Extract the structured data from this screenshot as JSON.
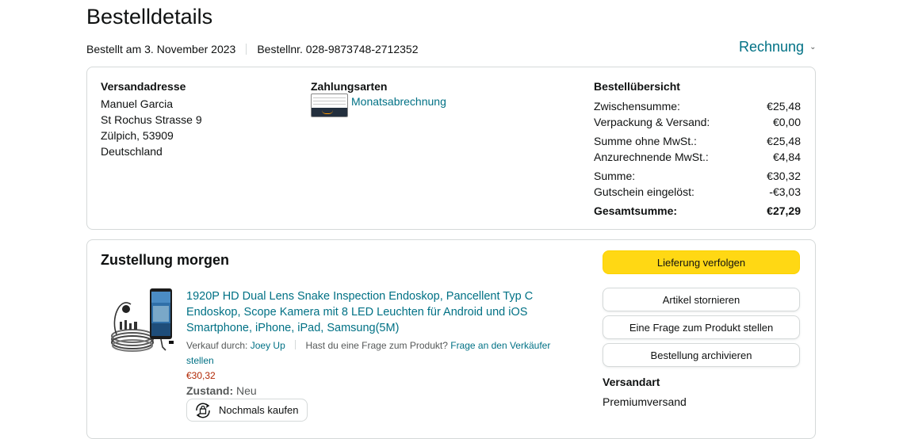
{
  "page_title": "Bestelldetails",
  "order_meta": {
    "ordered": "Bestellt am 3. November 2023",
    "order_number": "Bestellnr. 028-9873748-2712352"
  },
  "invoice_label": "Rechnung",
  "shipping_address": {
    "heading": "Versandadresse",
    "lines": [
      "Manuel Garcia",
      "St Rochus Strasse 9",
      "Zülpich, 53909",
      "Deutschland"
    ]
  },
  "payment": {
    "heading": "Zahlungsarten",
    "method": "Monatsabrechnung"
  },
  "summary": {
    "heading": "Bestellübersicht",
    "rows": [
      {
        "label": "Zwischensumme:",
        "value": "€25,48"
      },
      {
        "label": "Verpackung & Versand:",
        "value": "€0,00"
      },
      {
        "label": "Summe ohne MwSt.:",
        "value": "€25,48"
      },
      {
        "label": "Anzurechnende MwSt.:",
        "value": "€4,84"
      },
      {
        "label": "Summe:",
        "value": "€30,32"
      },
      {
        "label": "Gutschein eingelöst:",
        "value": "-€3,03"
      },
      {
        "label": "Gesamtsumme:",
        "value": "€27,29"
      }
    ]
  },
  "delivery": {
    "heading": "Zustellung morgen",
    "product": {
      "title": "1920P HD Dual Lens Snake Inspection Endoskop, Pancellent Typ C Endoskop, Scope Kamera mit 8 LED Leuchten für Android und iOS Smartphone, iPhone, iPad, Samsung(5M)",
      "sold_by_label": "Verkauf durch:",
      "seller": "Joey Up",
      "question_label": "Hast du eine Frage zum Produkt?",
      "question_link": "Frage an den Verkäufer stellen",
      "price": "€30,32",
      "condition_label": "Zustand:",
      "condition_value": "Neu",
      "buy_again": "Nochmals kaufen"
    },
    "buttons": {
      "track": "Lieferung verfolgen",
      "cancel": "Artikel stornieren",
      "ask": "Eine Frage zum Produkt stellen",
      "archive": "Bestellung archivieren"
    },
    "shipping_type_label": "Versandart",
    "shipping_type_value": "Premiumversand"
  },
  "colors": {
    "link": "#007185",
    "primary_button": "#ffd814",
    "price": "#b12704",
    "border": "#d5d9d9"
  }
}
